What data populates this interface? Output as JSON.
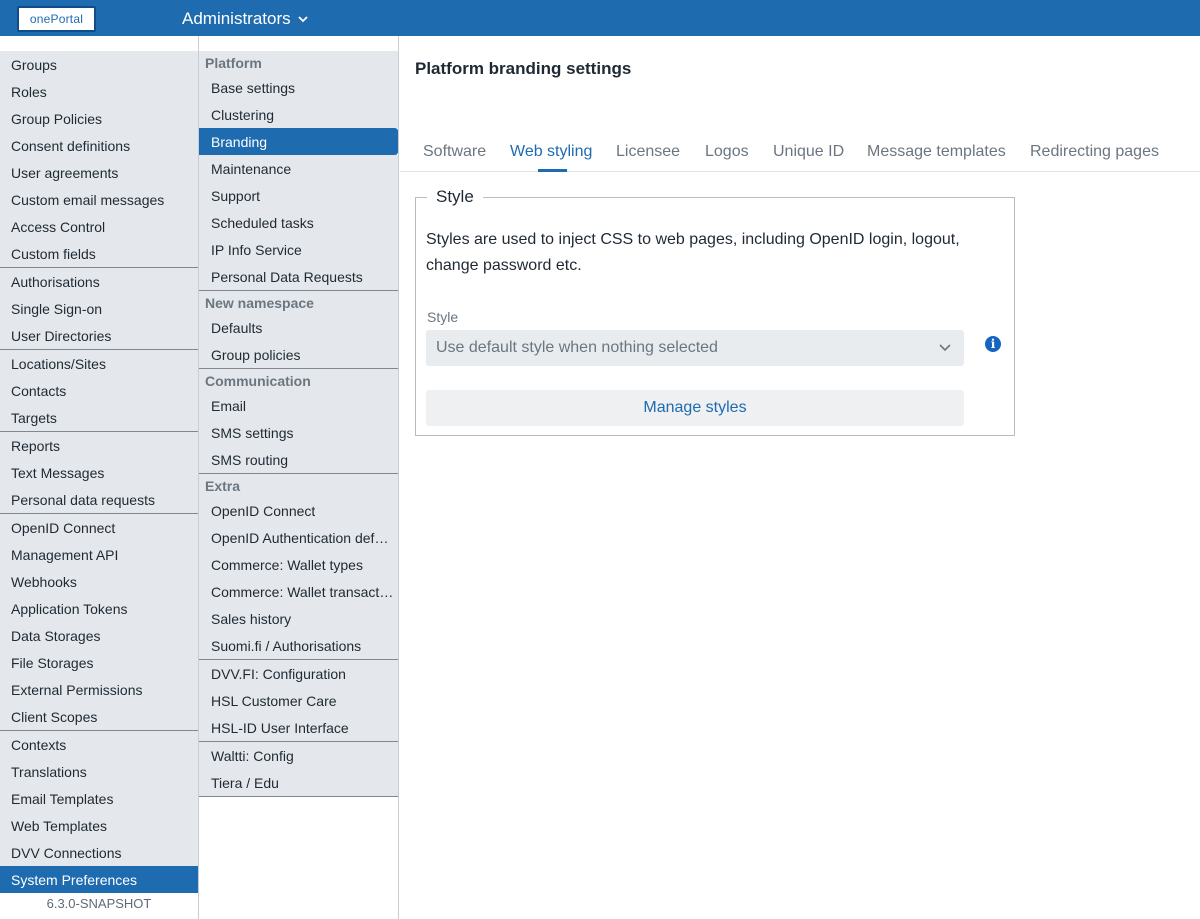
{
  "header": {
    "logo_text": "onePortal",
    "title": "Administrators",
    "title_icon": "chevron-down-icon"
  },
  "nav1": {
    "groups": [
      [
        "Groups",
        "Roles",
        "Group Policies",
        "Consent definitions",
        "User agreements",
        "Custom email messages",
        "Access Control",
        "Custom fields"
      ],
      [
        "Authorisations",
        "Single Sign-on",
        "User Directories"
      ],
      [
        "Locations/Sites",
        "Contacts",
        "Targets"
      ],
      [
        "Reports",
        "Text Messages",
        "Personal data requests"
      ],
      [
        "OpenID Connect",
        "Management API",
        "Webhooks",
        "Application Tokens",
        "Data Storages",
        "File Storages",
        "External Permissions",
        "Client Scopes"
      ],
      [
        "Contexts",
        "Translations",
        "Email Templates",
        "Web Templates",
        "DVV Connections",
        "System Preferences"
      ]
    ],
    "active": "System Preferences",
    "version": "6.3.0-SNAPSHOT"
  },
  "nav2": {
    "sections": [
      {
        "heading": "Platform",
        "items": [
          "Base settings",
          "Clustering",
          "Branding",
          "Maintenance",
          "Support",
          "Scheduled tasks",
          "IP Info Service",
          "Personal Data Requests"
        ]
      },
      {
        "heading": "New namespace",
        "items": [
          "Defaults",
          "Group policies"
        ]
      },
      {
        "heading": "Communication",
        "items": [
          "Email",
          "SMS settings",
          "SMS routing"
        ]
      },
      {
        "heading": "Extra",
        "items": [
          "OpenID Connect",
          "OpenID Authentication defa…",
          "Commerce: Wallet types",
          "Commerce: Wallet transacti…",
          "Sales history",
          "Suomi.fi / Authorisations"
        ]
      },
      {
        "heading": "",
        "items": [
          "DVV.FI: Configuration",
          "HSL Customer Care",
          "HSL-ID User Interface"
        ]
      },
      {
        "heading": "",
        "items": [
          "Waltti: Config",
          "Tiera / Edu"
        ]
      }
    ],
    "active": "Branding"
  },
  "main": {
    "title": "Platform branding settings",
    "tabs": [
      "Software",
      "Web styling",
      "Licensee",
      "Logos",
      "Unique ID",
      "Message templates",
      "Redirecting pages"
    ],
    "active_tab": "Web styling",
    "style_box": {
      "legend": "Style",
      "description": "Styles are used to inject CSS to web pages, including OpenID login, logout, change password etc.",
      "field_label": "Style",
      "select_value": "Use default style when nothing selected",
      "info_icon": "info-icon",
      "info_glyph": "i",
      "manage_button": "Manage styles"
    }
  },
  "colors": {
    "brand": "#1e6bb0",
    "nav_bg": "#e4e8ec"
  }
}
